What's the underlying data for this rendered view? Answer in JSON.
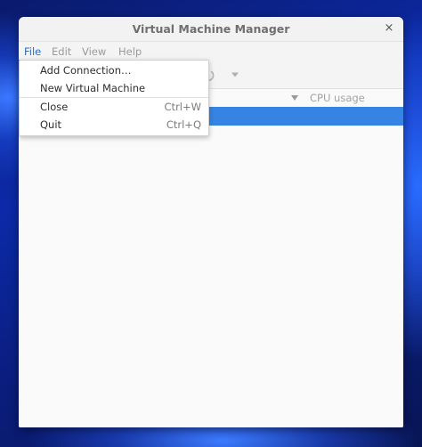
{
  "window": {
    "title": "Virtual Machine Manager",
    "close_glyph": "×"
  },
  "menubar": {
    "items": [
      {
        "label": "File",
        "active": true
      },
      {
        "label": "Edit"
      },
      {
        "label": "View"
      },
      {
        "label": "Help"
      }
    ]
  },
  "toolbar": {
    "icons": [
      "power-icon",
      "chevron-down-icon"
    ]
  },
  "columns": {
    "sort_icon": "triangle-down-icon",
    "cpu_usage": "CPU usage"
  },
  "file_menu": {
    "items": [
      {
        "label": "Add Connection…",
        "accel": ""
      },
      {
        "label": "New Virtual Machine",
        "accel": ""
      },
      {
        "label": "Close",
        "accel": "Ctrl+W"
      },
      {
        "label": "Quit",
        "accel": "Ctrl+Q"
      }
    ]
  },
  "colors": {
    "accent": "#3584e4",
    "active_menu": "#2a6bbf"
  }
}
